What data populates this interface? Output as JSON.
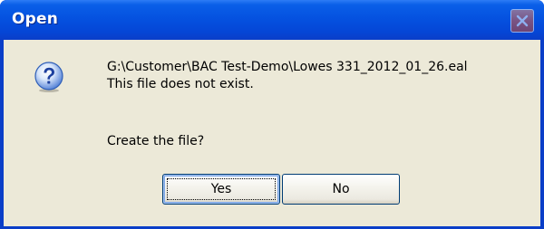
{
  "window": {
    "title": "Open",
    "close_icon": "close-icon"
  },
  "message": {
    "icon": "question-icon",
    "path_line": "G:\\Customer\\BAC Test-Demo\\Lowes 331_2012_01_26.eal",
    "status_line": "This file does not exist.",
    "prompt": "Create the file?"
  },
  "buttons": {
    "yes_label": "Yes",
    "no_label": "No",
    "default": "yes"
  },
  "colors": {
    "titlebar": "#0552e0",
    "client_background": "#ece9d8",
    "button_border": "#003c74"
  }
}
